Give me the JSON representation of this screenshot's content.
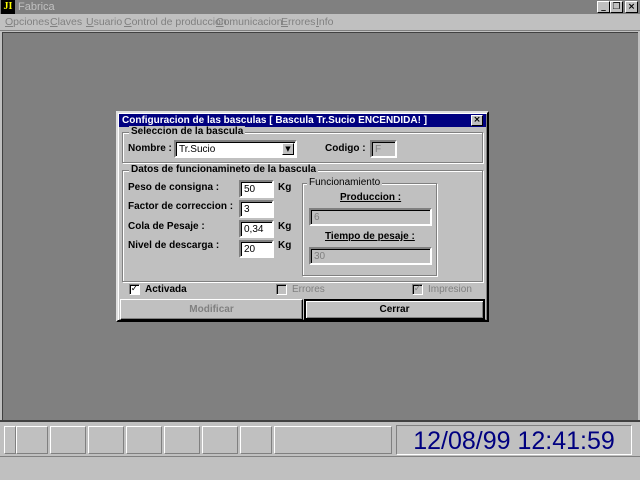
{
  "window": {
    "title": "Fabrica",
    "icon": "JI",
    "minimize_icon": "minimize-icon",
    "restore_icon": "restore-icon",
    "close_icon": "close-icon"
  },
  "menu": [
    "Opciones",
    "Claves",
    "Usuario",
    "Control de produccion",
    "Comunicacion",
    "Errores",
    "Info"
  ],
  "dialog": {
    "title": "Configuracion de las basculas [ Bascula Tr.Sucio ENCENDIDA! ]",
    "seleccion": {
      "title": "Seleccion de la bascula",
      "nombre_label": "Nombre :",
      "nombre_value": "Tr.Sucio",
      "codigo_label": "Codigo :",
      "codigo_value": "F"
    },
    "datos": {
      "title": "Datos de funcionamineto de la bascula",
      "fields": [
        {
          "label": "Peso de consigna :",
          "value": "50",
          "unit": "Kg"
        },
        {
          "label": "Factor de correccion :",
          "value": "3",
          "unit": ""
        },
        {
          "label": "Cola de Pesaje :",
          "value": "0,34",
          "unit": "Kg"
        },
        {
          "label": "Nivel de descarga :",
          "value": "20",
          "unit": "Kg"
        }
      ],
      "funcionamiento": {
        "title": "Funcionamiento",
        "produccion_label": "Produccion :",
        "produccion_value": "6",
        "tiempo_label": "Tiempo de pesaje :",
        "tiempo_value": "30"
      }
    },
    "checks": {
      "activada": {
        "label": "Activada",
        "checked": true
      },
      "errores": {
        "label": "Errores",
        "checked": false
      },
      "impresion": {
        "label": "Impresion",
        "checked": true
      }
    },
    "buttons": {
      "modificar": "Modificar",
      "cerrar": "Cerrar"
    }
  },
  "status": {
    "clock": "12/08/99 12:41:59"
  },
  "colors": {
    "title_active": "#000080",
    "workspace": "#808080",
    "clock": "#000080"
  }
}
